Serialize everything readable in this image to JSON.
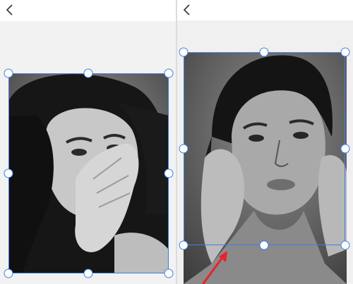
{
  "left_panel": {
    "back_icon": "chevron-left-icon",
    "photo": {
      "type": "black-and-white portrait, hand covering mouth"
    },
    "crop_handles": [
      "top-left",
      "top-center",
      "top-right",
      "middle-left",
      "middle-right",
      "bottom-left",
      "bottom-center",
      "bottom-right"
    ]
  },
  "right_panel": {
    "back_icon": "chevron-left-icon",
    "photo": {
      "type": "black-and-white portrait, hands on cheeks"
    },
    "crop_handles": [
      "top-left",
      "top-center",
      "top-right",
      "middle-left",
      "middle-right",
      "bottom-left",
      "bottom-center",
      "bottom-right"
    ],
    "annotation": "red-arrow-icon"
  },
  "colors": {
    "crop_border": "#3d7fe0",
    "handle_fill": "#ffffff",
    "annotation": "#e8232b"
  }
}
